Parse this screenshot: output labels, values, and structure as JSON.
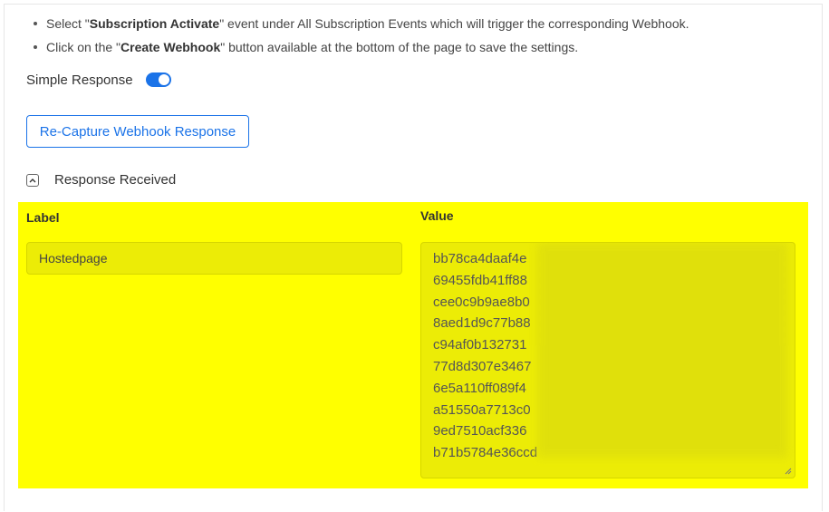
{
  "instructions": [
    {
      "before": "Select \"",
      "bold": "Subscription Activate",
      "after": "\" event under All Subscription Events which will trigger the corresponding Webhook."
    },
    {
      "before": "Click on the \"",
      "bold": "Create Webhook",
      "after": "\" button available at the bottom of the page to save the settings."
    }
  ],
  "simple_response": {
    "label": "Simple Response",
    "enabled": true
  },
  "recapture_button": "Re-Capture Webhook Response",
  "response_section": {
    "title": "Response Received",
    "expanded": true
  },
  "columns": {
    "label": "Label",
    "value": "Value"
  },
  "row": {
    "label": "Hostedpage",
    "value_lines": [
      "bb78ca4daaf4e",
      "69455fdb41ff88",
      "cee0c9b9ae8b0",
      "8aed1d9c77b88",
      "c94af0b132731",
      "77d8d307e3467",
      "6e5a110ff089f4",
      "a51550a7713c0",
      "9ed7510acf336",
      "b71b5784e36ccd"
    ]
  },
  "colors": {
    "accent": "#1b73e8",
    "highlight": "#ffff00"
  }
}
